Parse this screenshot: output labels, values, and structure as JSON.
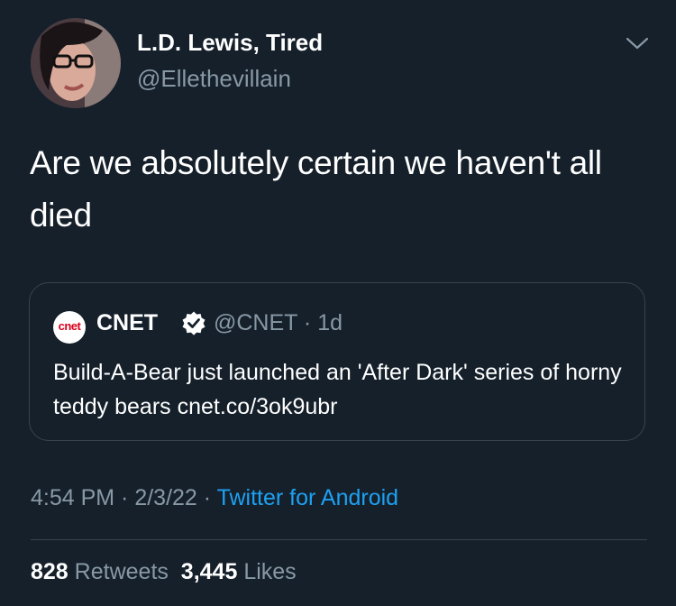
{
  "author": {
    "name": "L.D. Lewis, Tired",
    "handle": "@Ellethevillain",
    "avatar_icon": "profile-photo"
  },
  "tweet": {
    "text": "Are we absolutely certain we haven't all died"
  },
  "quoted": {
    "logo_text": "cnet",
    "name": "CNET",
    "handle_time": "@CNET · 1d",
    "text": "Build-A-Bear just launched an 'After Dark' series of horny teddy bears cnet.co/3ok9ubr"
  },
  "meta": {
    "time": "4:54 PM",
    "sep1": " · ",
    "date": "2/3/22",
    "sep2": " · ",
    "source": "Twitter for Android"
  },
  "stats": {
    "retweets_count": "828",
    "retweets_label": "Retweets",
    "likes_count": "3,445",
    "likes_label": "Likes"
  },
  "colors": {
    "background": "#15202b",
    "secondary_text": "#8899a6",
    "link": "#1da1f2",
    "border": "#38444d",
    "verified": "#ffffff"
  }
}
